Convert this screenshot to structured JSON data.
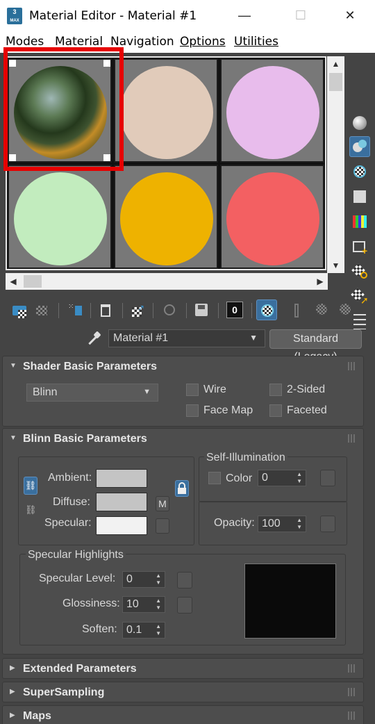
{
  "window": {
    "title": "Material Editor - Material #1",
    "app_icon_text": "3",
    "app_icon_sub": "MAX",
    "minimize": "—",
    "maximize": "☐",
    "close": "✕"
  },
  "menu": {
    "items": [
      "Modes",
      "Material",
      "Navigation",
      "Options",
      "Utilities"
    ]
  },
  "slots": {
    "colors": [
      "#e1cbba",
      "#e8bcec",
      "#c2ecbe",
      "#eeb200",
      "#f36062"
    ]
  },
  "material_name": "Material #1",
  "material_type": "Standard (Legacy)",
  "shader_basic": {
    "title": "Shader Basic Parameters",
    "shader": "Blinn",
    "wire": "Wire",
    "two_sided": "2-Sided",
    "face_map": "Face Map",
    "faceted": "Faceted"
  },
  "blinn_basic": {
    "title": "Blinn Basic Parameters",
    "ambient": "Ambient:",
    "diffuse": "Diffuse:",
    "specular": "Specular:",
    "ambient_color": "#c4c4c4",
    "diffuse_color": "#c4c4c4",
    "specular_color": "#f2f2f2",
    "m_button": "M",
    "self_illum": "Self-Illumination",
    "color_label": "Color",
    "color_value": "0",
    "opacity_label": "Opacity:",
    "opacity_value": "100",
    "spec_highlights": "Specular Highlights",
    "spec_level_label": "Specular Level:",
    "spec_level": "0",
    "glossiness_label": "Glossiness:",
    "glossiness": "10",
    "soften_label": "Soften:",
    "soften": "0.1"
  },
  "collapsed": {
    "extended": "Extended Parameters",
    "supersampling": "SuperSampling",
    "maps": "Maps"
  }
}
